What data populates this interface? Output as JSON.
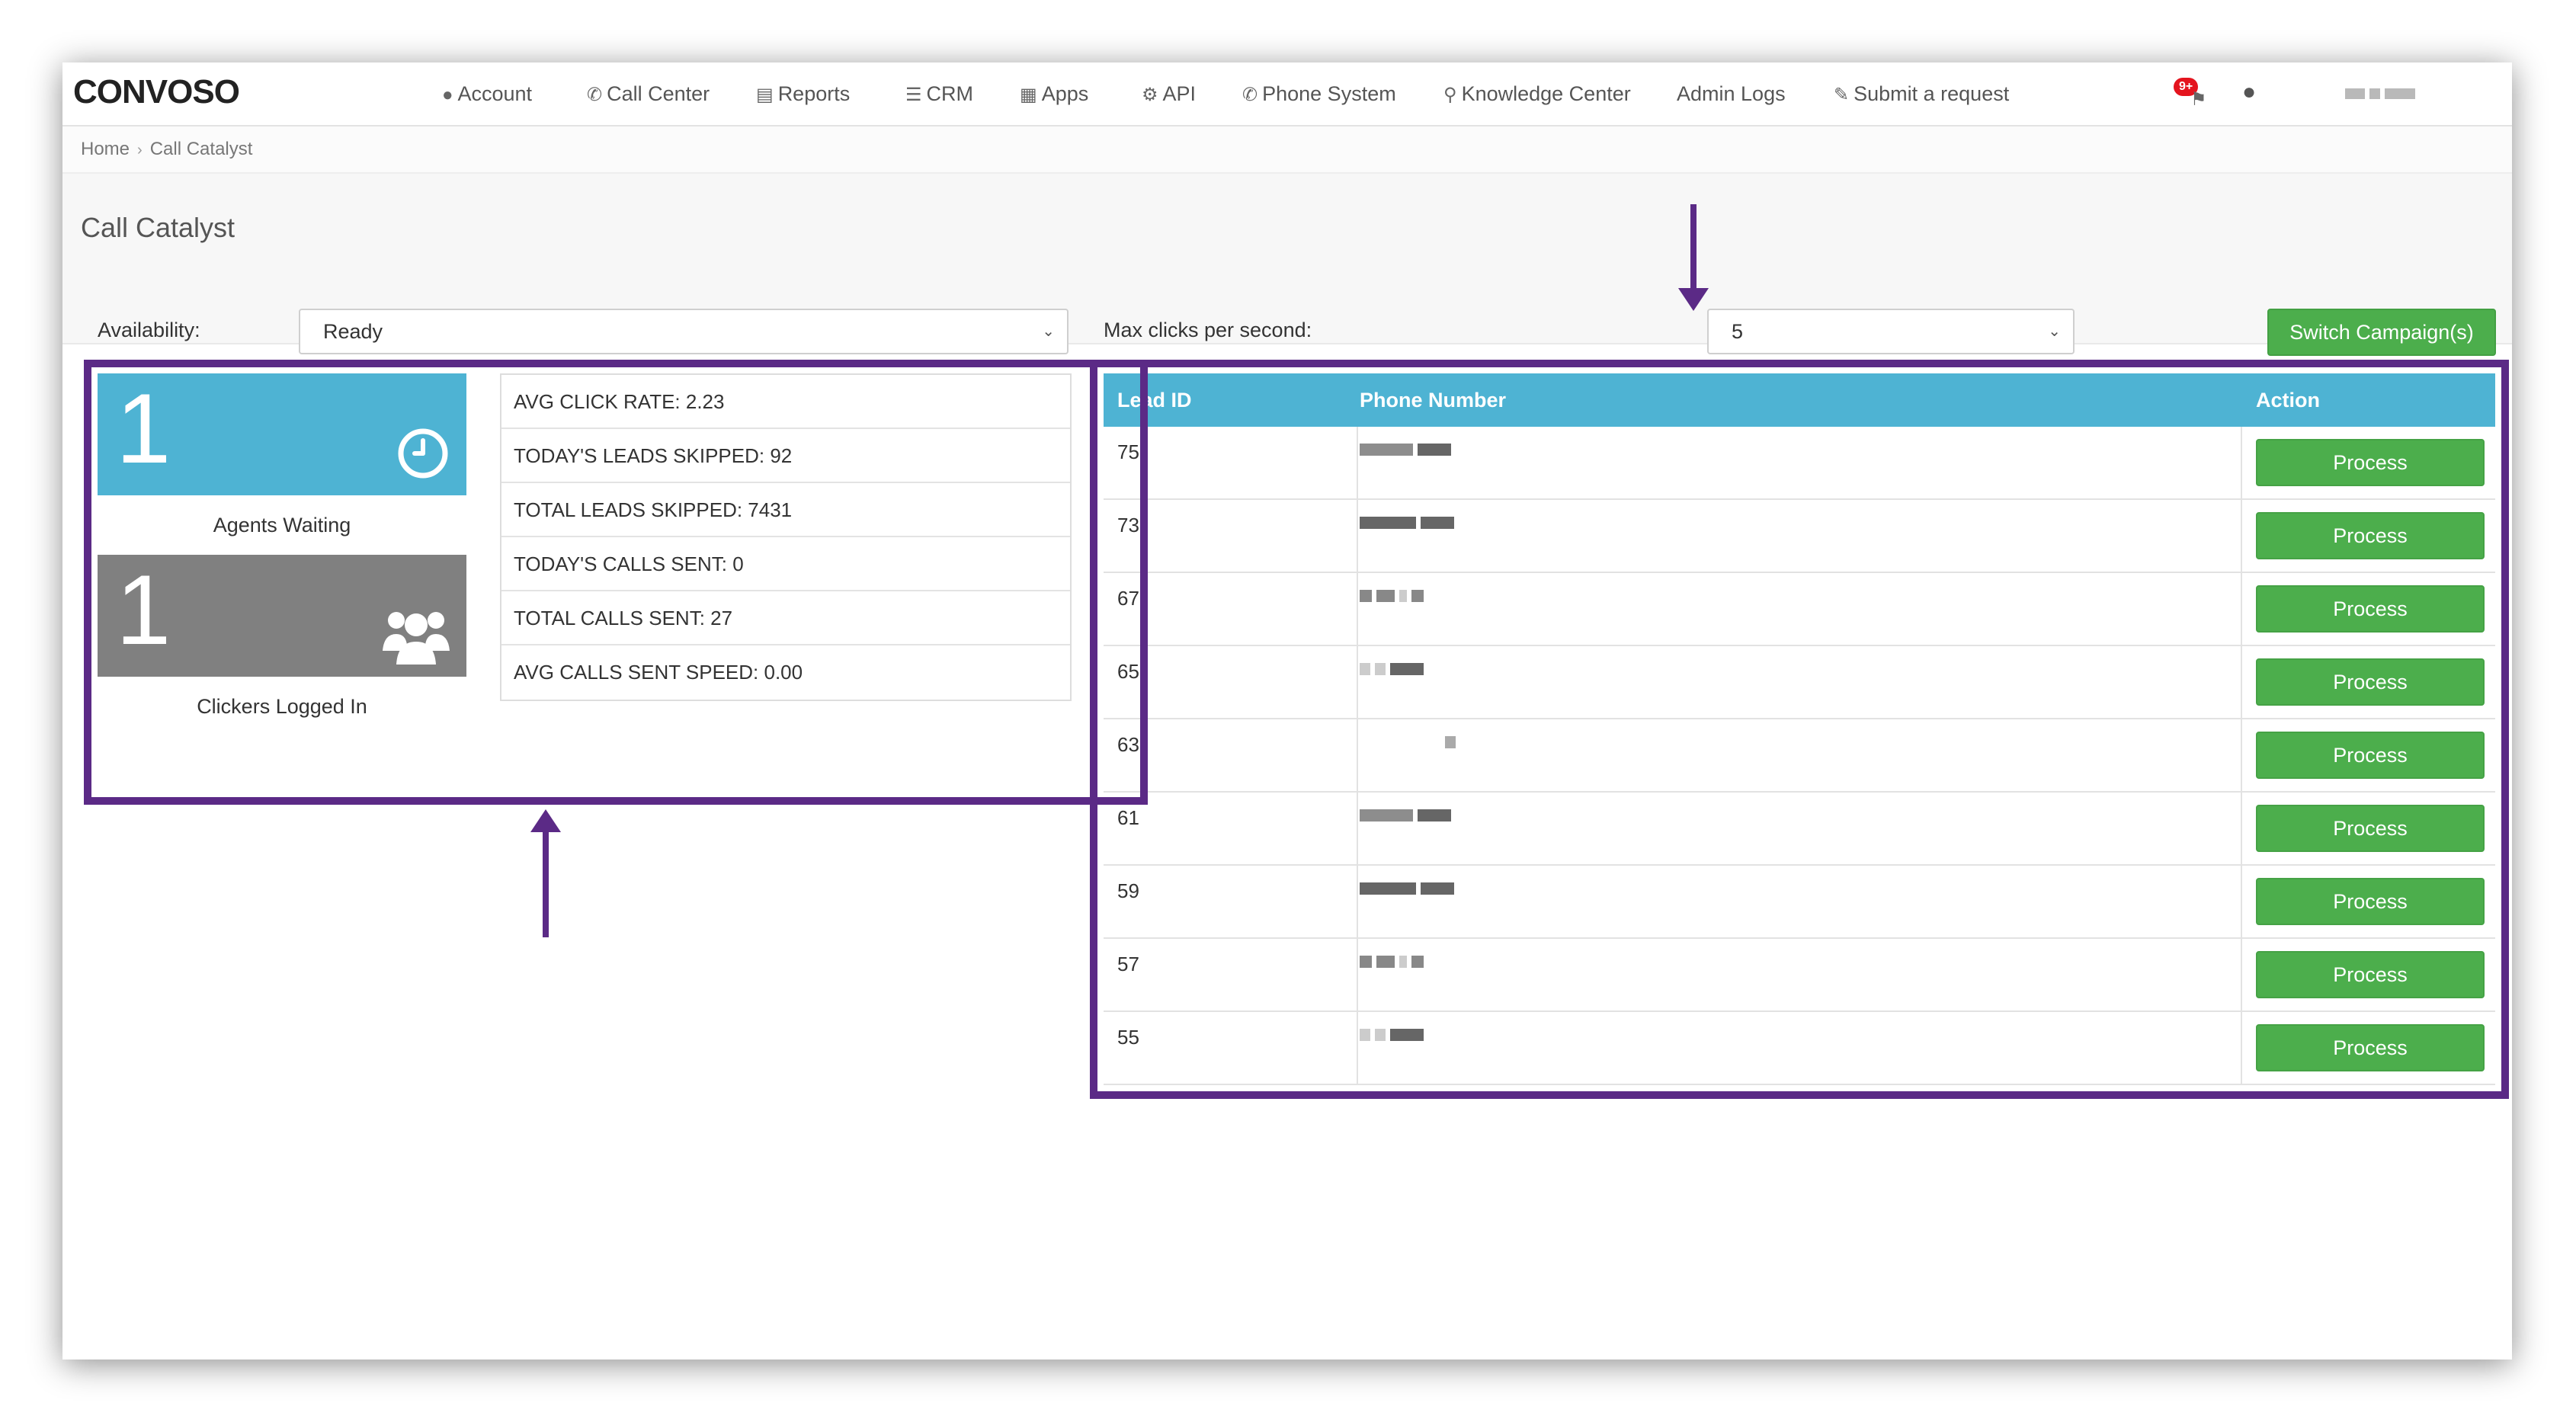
{
  "app": {
    "logo": "CONVOSO"
  },
  "nav": {
    "items": [
      {
        "icon": "user-icon",
        "glyph": "👤",
        "label": "Account"
      },
      {
        "icon": "phone-icon",
        "glyph": "✆",
        "label": "Call Center"
      },
      {
        "icon": "bar-chart-icon",
        "glyph": "📊",
        "label": "Reports"
      },
      {
        "icon": "list-icon",
        "glyph": "☰",
        "label": "CRM"
      },
      {
        "icon": "grid-icon",
        "glyph": "▦",
        "label": "Apps"
      },
      {
        "icon": "gear-icon",
        "glyph": "⚙",
        "label": "API"
      },
      {
        "icon": "phone-icon",
        "glyph": "✆",
        "label": "Phone System"
      },
      {
        "icon": "lightbulb-icon",
        "glyph": "💡",
        "label": "Knowledge Center"
      },
      {
        "icon": "",
        "glyph": "",
        "label": "Admin Logs"
      },
      {
        "icon": "ticket-icon",
        "glyph": "✎",
        "label": "Submit a request"
      }
    ],
    "notification_badge": "9+"
  },
  "breadcrumb": {
    "home": "Home",
    "current": "Call Catalyst"
  },
  "page": {
    "title": "Call Catalyst"
  },
  "controls": {
    "availability_label": "Availability:",
    "availability_value": "Ready",
    "max_clicks_label": "Max clicks per second:",
    "max_clicks_value": "5",
    "switch_button": "Switch Campaign(s)"
  },
  "tiles": {
    "agents_waiting": {
      "value": "1",
      "label": "Agents Waiting",
      "color": "#4eb3d3"
    },
    "clickers_logged_in": {
      "value": "1",
      "label": "Clickers Logged In",
      "color": "#808080"
    }
  },
  "stats": [
    "AVG CLICK RATE: 2.23",
    "TODAY'S LEADS SKIPPED: 92",
    "TOTAL LEADS SKIPPED: 7431",
    "TODAY'S CALLS SENT: 0",
    "TOTAL CALLS SENT: 27",
    "AVG CALLS SENT SPEED: 0.00"
  ],
  "table": {
    "headers": {
      "lead_id": "Lead ID",
      "phone": "Phone Number",
      "action": "Action"
    },
    "rows": [
      {
        "lead_id": "75",
        "action": "Process"
      },
      {
        "lead_id": "73",
        "action": "Process"
      },
      {
        "lead_id": "67",
        "action": "Process"
      },
      {
        "lead_id": "65",
        "action": "Process"
      },
      {
        "lead_id": "63",
        "action": "Process"
      },
      {
        "lead_id": "61",
        "action": "Process"
      },
      {
        "lead_id": "59",
        "action": "Process"
      },
      {
        "lead_id": "57",
        "action": "Process"
      },
      {
        "lead_id": "55",
        "action": "Process"
      }
    ]
  },
  "colors": {
    "accent_blue": "#4eb3d3",
    "button_green": "#4cae4c",
    "highlight_purple": "#5b2a86",
    "badge_red": "#e4141e"
  }
}
